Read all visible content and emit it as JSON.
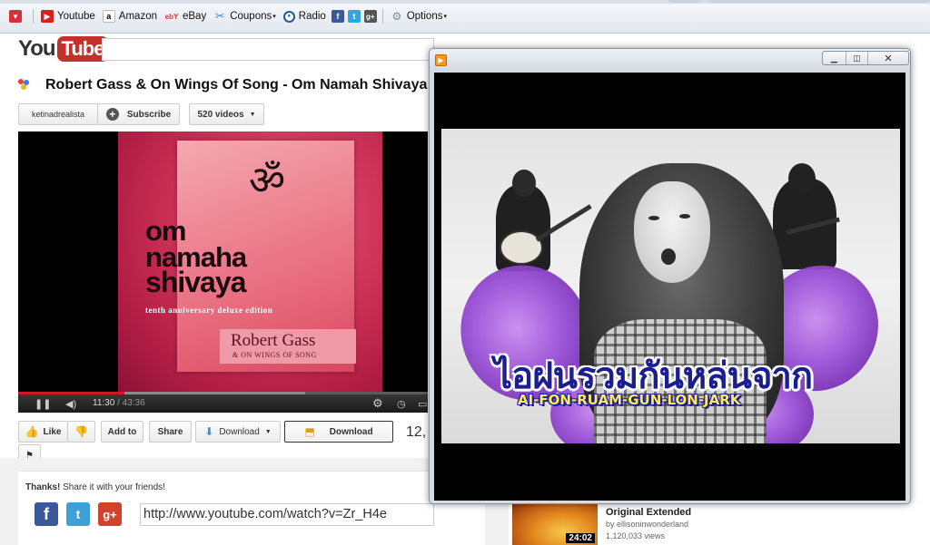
{
  "bookmarks": {
    "items": [
      {
        "label": "Youtube"
      },
      {
        "label": "Amazon"
      },
      {
        "label": "eBay"
      },
      {
        "label": "Coupons"
      },
      {
        "label": "Radio"
      }
    ],
    "options_label": "Options"
  },
  "youtube": {
    "logo_you": "You",
    "logo_tube": "Tube",
    "video_title": "Robert Gass & On Wings Of Song - Om Namah Shivaya (C",
    "channel_name": "ketinadrealista",
    "subscribe_label": "Subscribe",
    "videos_label": "520 videos",
    "player": {
      "elapsed": "11:30",
      "duration": "/ 43:36",
      "progress_played": 0.26,
      "progress_loaded": 0.7
    },
    "album": {
      "om_symbol": "ॐ",
      "line1": "om",
      "line2": "namaha",
      "line3": "shivaya",
      "line4": "tenth anniversary deluxe edition",
      "artist1": "Robert Gass",
      "artist2": "& ON WINGS OF SONG"
    },
    "actions": {
      "like_label": "Like",
      "add_to_label": "Add to",
      "share_label": "Share",
      "download_label": "Download",
      "download2_label": "Download",
      "flag_label": "⚑"
    },
    "view_count_partial": "12,",
    "share": {
      "prompt_bold": "Thanks!",
      "prompt_rest": " Share it with your friends!",
      "url": "http://www.youtube.com/watch?v=Zr_H4e"
    },
    "sidebar": {
      "title": "Original Extended",
      "by": "by ellisoninwonderland",
      "views": "1,120,033 views",
      "duration": "24:02"
    }
  },
  "popup": {
    "lyric_thai": "ไอฝนรวมกันหล่นจาก",
    "lyric_roman": "AI-FON-RUAM-GUN-LON-JARK"
  },
  "colors": {
    "youtube_red": "#c4302b",
    "lyric_blue": "#1a1e8f",
    "lyric_yellow": "#ffea5a",
    "petal_purple": "#9a52d8"
  }
}
